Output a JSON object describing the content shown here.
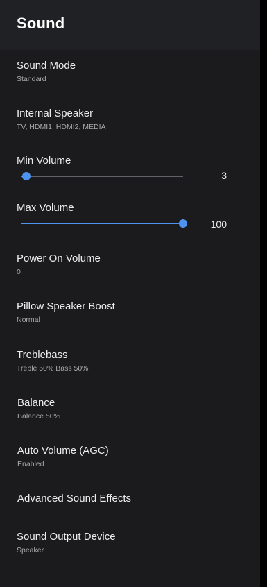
{
  "header": {
    "title": "Sound"
  },
  "accent_color": "#4d94f0",
  "items": [
    {
      "title": "Sound Mode",
      "subtitle": "Standard"
    },
    {
      "title": "Internal Speaker",
      "subtitle": "TV, HDMI1, HDMI2, MEDIA"
    }
  ],
  "min_volume": {
    "title": "Min Volume",
    "value": "3",
    "level": 0.03
  },
  "max_volume": {
    "title": "Max Volume",
    "value": "100",
    "level": 1.0
  },
  "items2": [
    {
      "title": "Power On Volume",
      "subtitle": "0"
    },
    {
      "title": "Pillow Speaker Boost",
      "subtitle": "Normal"
    },
    {
      "title": "Treblebass",
      "subtitle": "Treble 50% Bass 50%"
    },
    {
      "title": "Balance",
      "subtitle": "Balance 50%"
    },
    {
      "title": "Auto Volume (AGC)",
      "subtitle": "Enabled"
    },
    {
      "title": "Advanced Sound Effects"
    },
    {
      "title": "Sound Output Device",
      "subtitle": "Speaker"
    }
  ]
}
